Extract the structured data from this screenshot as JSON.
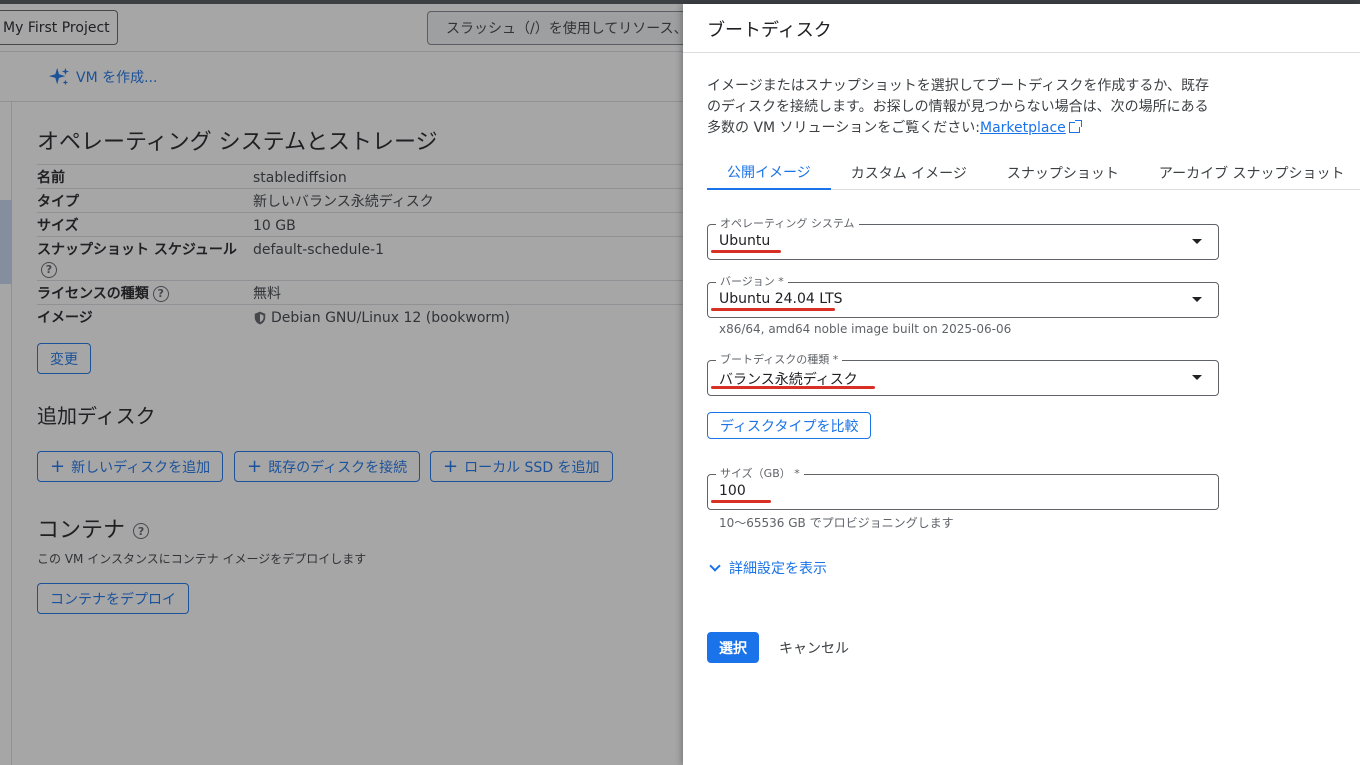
{
  "header": {
    "project_label": "My First Project",
    "search_placeholder": "スラッシュ（/）を使用してリソース、"
  },
  "vm_create": {
    "label": "VM を作成..."
  },
  "os_storage": {
    "title": "オペレーティング システムとストレージ",
    "rows": [
      {
        "key": "名前",
        "value": "stablediffsion"
      },
      {
        "key": "タイプ",
        "value": "新しいバランス永続ディスク"
      },
      {
        "key": "サイズ",
        "value": "10 GB"
      },
      {
        "key": "スナップショット スケジュール",
        "value": "default-schedule-1"
      },
      {
        "key": "ライセンスの種類",
        "value": "無料"
      },
      {
        "key": "イメージ",
        "value": "Debian GNU/Linux 12 (bookworm)"
      }
    ],
    "change_label": "変更"
  },
  "additional_disks": {
    "title": "追加ディスク",
    "add_new": "新しいディスクを追加",
    "attach_existing": "既存のディスクを接続",
    "add_local_ssd": "ローカル SSD を追加"
  },
  "container": {
    "title": "コンテナ",
    "description": "この VM インスタンスにコンテナ イメージをデプロイします",
    "deploy_label": "コンテナをデプロイ"
  },
  "drawer": {
    "title": "ブートディスク",
    "description_line1": "イメージまたはスナップショットを選択してブートディスクを作成するか、既存",
    "description_line2": "のディスクを接続します。お探しの情報が見つからない場合は、次の場所にある",
    "description_line3": "多数の VM ソリューションをご覧ください:",
    "marketplace_link": "Marketplace",
    "tabs": [
      "公開イメージ",
      "カスタム イメージ",
      "スナップショット",
      "アーカイブ スナップショット"
    ],
    "os_field": {
      "label": "オペレーティング システム",
      "value": "Ubuntu"
    },
    "version_field": {
      "label": "バージョン *",
      "value": "Ubuntu 24.04 LTS",
      "helper": "x86/64, amd64 noble image built on 2025-06-06"
    },
    "disk_type_field": {
      "label": "ブートディスクの種類 *",
      "value": "バランス永続ディスク"
    },
    "compare_label": "ディスクタイプを比較",
    "size_field": {
      "label": "サイズ（GB） *",
      "value": "100",
      "helper": "10〜65536 GB でプロビジョニングします"
    },
    "advanced_label": "詳細設定を表示",
    "select_label": "選択",
    "cancel_label": "キャンセル"
  },
  "colors": {
    "accent": "#1a73e8",
    "annotation": "#d93025"
  }
}
